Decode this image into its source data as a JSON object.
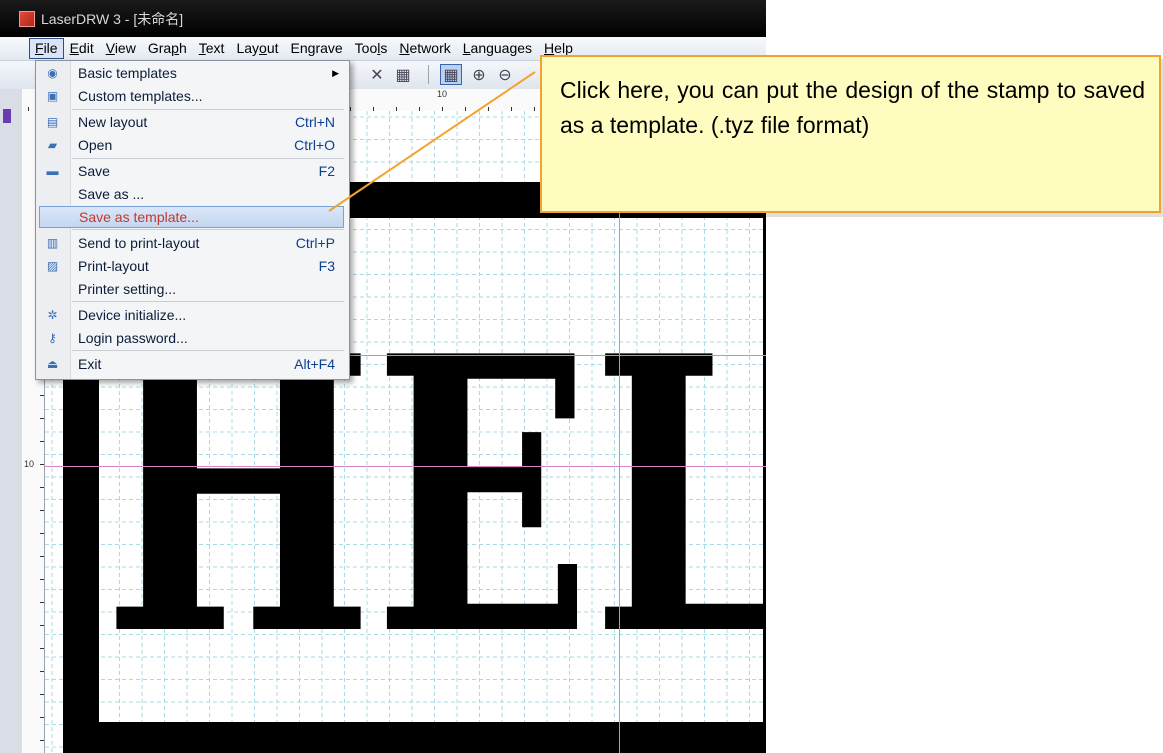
{
  "window": {
    "title": "LaserDRW 3 - [未命名]"
  },
  "menubar": {
    "items": [
      {
        "pre": "",
        "u": "F",
        "post": "ile"
      },
      {
        "pre": "",
        "u": "E",
        "post": "dit"
      },
      {
        "pre": "",
        "u": "V",
        "post": "iew"
      },
      {
        "pre": "Gra",
        "u": "p",
        "post": "h"
      },
      {
        "pre": "",
        "u": "T",
        "post": "ext"
      },
      {
        "pre": "Lay",
        "u": "o",
        "post": "ut"
      },
      {
        "pre": "En",
        "u": "g",
        "post": "rave"
      },
      {
        "pre": "Too",
        "u": "l",
        "post": "s"
      },
      {
        "pre": "",
        "u": "N",
        "post": "etwork"
      },
      {
        "pre": "",
        "u": "L",
        "post": "anguages"
      },
      {
        "pre": "",
        "u": "H",
        "post": "elp"
      }
    ]
  },
  "file_menu": {
    "items": [
      {
        "label": "Basic templates",
        "shortcut": "",
        "submenu": true,
        "icon": "template-icon"
      },
      {
        "label": "Custom templates...",
        "shortcut": "",
        "icon": "custom-template-icon"
      },
      {
        "label": "New layout",
        "shortcut": "Ctrl+N",
        "icon": "new-layout-icon"
      },
      {
        "label": "Open",
        "shortcut": "Ctrl+O",
        "icon": "open-folder-icon"
      },
      {
        "label": "Save",
        "shortcut": "F2",
        "icon": "save-disk-icon"
      },
      {
        "label": "Save as ...",
        "shortcut": "",
        "icon": ""
      },
      {
        "label": "Save as template...",
        "shortcut": "",
        "icon": "",
        "highlighted": true
      },
      {
        "label": "Send to print-layout",
        "shortcut": "Ctrl+P",
        "icon": "send-print-icon"
      },
      {
        "label": "Print-layout",
        "shortcut": "F3",
        "icon": "printer-icon"
      },
      {
        "label": "Printer setting...",
        "shortcut": "",
        "icon": ""
      },
      {
        "label": "Device initialize...",
        "shortcut": "",
        "icon": "gear-icon"
      },
      {
        "label": "Login password...",
        "shortcut": "",
        "icon": "key-icon"
      },
      {
        "label": "Exit",
        "shortcut": "Alt+F4",
        "icon": "eject-icon"
      }
    ]
  },
  "rulers": {
    "top_label": "10",
    "left_label": "10"
  },
  "canvas": {
    "stamp_text": "HEL"
  },
  "callout": {
    "text": "Click here, you can put the design of the stamp to saved as a template. (.tyz file format)"
  },
  "colors": {
    "callout_bg": "#fefdbf",
    "callout_border": "#f2a32c",
    "highlight_text": "#c0392b",
    "grid": "#a9dbe6"
  }
}
